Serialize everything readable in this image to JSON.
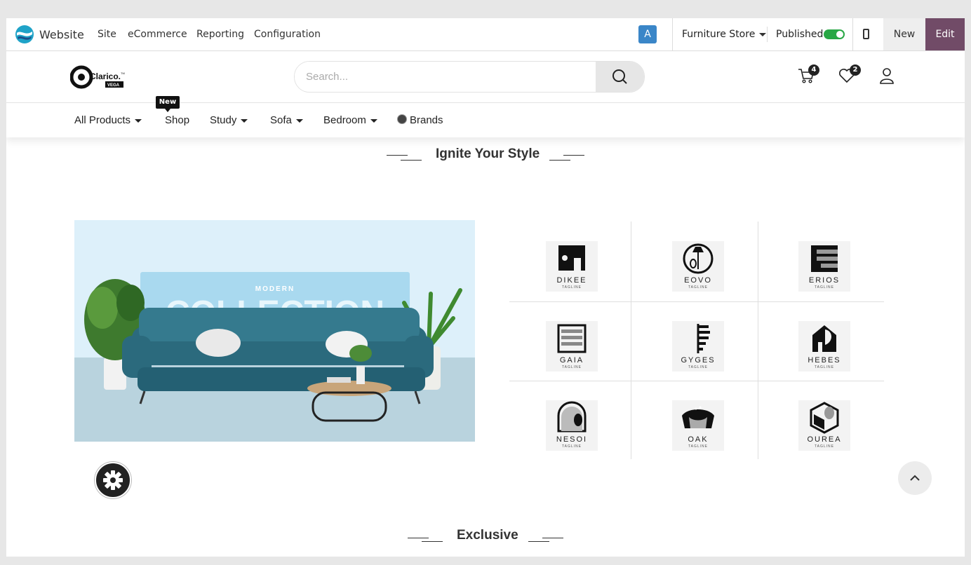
{
  "adminbar": {
    "app_name": "Website",
    "menu": [
      "Site",
      "eCommerce",
      "Reporting",
      "Configuration"
    ],
    "user_initial": "A",
    "store_name": "Furniture Store",
    "published_label": "Published",
    "published": true,
    "new_label": "New",
    "edit_label": "Edit",
    "colors": {
      "edit": "#714b67",
      "toggle": "#28a745",
      "avatar": "#3a86c8"
    }
  },
  "header": {
    "brand": {
      "name": "Clarico.",
      "sub": "VEGA",
      "tm": "TM"
    },
    "search_placeholder": "Search...",
    "cart_count": "4",
    "wishlist_count": "2",
    "icons": [
      "search-icon",
      "cart-icon",
      "heart-icon",
      "user-icon"
    ]
  },
  "nav": {
    "new_tag": "New",
    "items": [
      {
        "label": "All Products",
        "dropdown": true
      },
      {
        "label": "Shop",
        "dropdown": false
      },
      {
        "label": "Study",
        "dropdown": true
      },
      {
        "label": "Sofa",
        "dropdown": true
      },
      {
        "label": "Bedroom",
        "dropdown": true
      },
      {
        "label": "Brands",
        "dropdown": false
      }
    ]
  },
  "section1": {
    "title": "Ignite Your Style",
    "banner": {
      "small": "MODERN",
      "big": "COLLECTION"
    }
  },
  "brands": [
    {
      "name": "DIKEE",
      "tagline": "TAGLINE"
    },
    {
      "name": "EOVO",
      "tagline": "TAGLINE"
    },
    {
      "name": "ERIOS",
      "tagline": "TAGLINE"
    },
    {
      "name": "GAIA",
      "tagline": "TAGLINE"
    },
    {
      "name": "GYGES",
      "tagline": "TAGLINE"
    },
    {
      "name": "HEBES",
      "tagline": "TAGLINE"
    },
    {
      "name": "NESOI",
      "tagline": "TAGLINE"
    },
    {
      "name": "OAK",
      "tagline": "TAGLINE"
    },
    {
      "name": "OUREA",
      "tagline": "TAGLINE"
    }
  ],
  "section2": {
    "title": "Exclusive"
  }
}
